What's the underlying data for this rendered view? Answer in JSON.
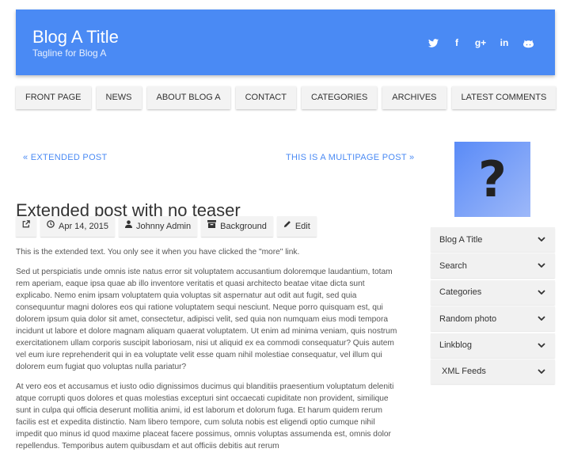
{
  "header": {
    "title": "Blog A Title",
    "tagline": "Tagline for Blog A",
    "social_icons": [
      "twitter-icon",
      "facebook-icon",
      "google-plus-icon",
      "linkedin-icon",
      "github-icon"
    ]
  },
  "nav": {
    "items": [
      "FRONT PAGE",
      "NEWS",
      "ABOUT BLOG A",
      "CONTACT",
      "CATEGORIES",
      "ARCHIVES",
      "LATEST COMMENTS"
    ]
  },
  "post_nav": {
    "prev": "« EXTENDED POST",
    "next": "THIS IS A MULTIPAGE POST »"
  },
  "post": {
    "title": "Extended post with no teaser",
    "meta": {
      "permalink_icon": "external-link-icon",
      "date": "Apr 14, 2015",
      "author": "Johnny Admin",
      "category": "Background",
      "edit": "Edit"
    },
    "paragraphs": [
      "This is the extended text. You only see it when you have clicked the \"more\" link.",
      "Sed ut perspiciatis unde omnis iste natus error sit voluptatem accusantium doloremque laudantium, totam rem aperiam, eaque ipsa quae ab illo inventore veritatis et quasi architecto beatae vitae dicta sunt explicabo. Nemo enim ipsam voluptatem quia voluptas sit aspernatur aut odit aut fugit, sed quia consequuntur magni dolores eos qui ratione voluptatem sequi nesciunt. Neque porro quisquam est, qui dolorem ipsum quia dolor sit amet, consectetur, adipisci velit, sed quia non numquam eius modi tempora incidunt ut labore et dolore magnam aliquam quaerat voluptatem. Ut enim ad minima veniam, quis nostrum exercitationem ullam corporis suscipit laboriosam, nisi ut aliquid ex ea commodi consequatur? Quis autem vel eum iure reprehenderit qui in ea voluptate velit esse quam nihil molestiae consequatur, vel illum qui dolorem eum fugiat quo voluptas nulla pariatur?",
      "At vero eos et accusamus et iusto odio dignissimos ducimus qui blanditiis praesentium voluptatum deleniti atque corrupti quos dolores et quas molestias excepturi sint occaecati cupiditate non provident, similique sunt in culpa qui officia deserunt mollitia animi, id est laborum et dolorum fuga. Et harum quidem rerum facilis est et expedita distinctio. Nam libero tempore, cum soluta nobis est eligendi optio cumque nihil impedit quo minus id quod maxime placeat facere possimus, omnis voluptas assumenda est, omnis dolor repellendus. Temporibus autem quibusdam et aut officiis debitis aut rerum"
    ]
  },
  "sidebar": {
    "avatar_glyph": "?",
    "widgets": [
      "Blog A Title",
      "Search",
      "Categories",
      "Random photo",
      "Linkblog",
      "XML Feeds"
    ]
  }
}
